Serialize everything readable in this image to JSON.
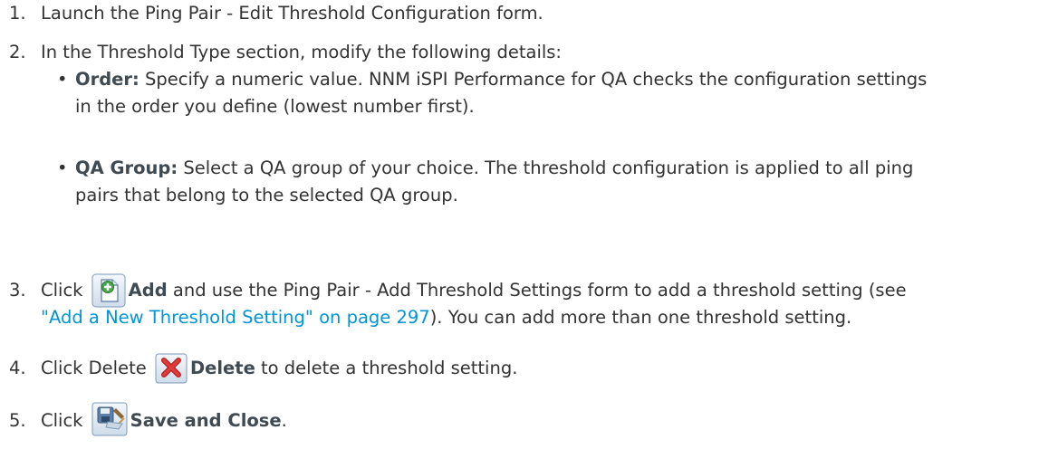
{
  "steps": [
    {
      "num": "1.",
      "text": "Launch the Ping Pair - Edit Threshold Configuration form."
    },
    {
      "num": "2.",
      "text": "In the Threshold Type section, modify the following details:",
      "bullets": [
        {
          "term": "Order:",
          "desc_line1": " Specify a numeric value. NNM iSPI Performance for QA checks the configuration settings",
          "desc_line2": "in the order you define (lowest number first)."
        },
        {
          "term": "QA Group:",
          "desc_line1": " Select a QA group of your choice. The threshold configuration is applied to all ping",
          "desc_line2": "pairs that belong to the selected QA group."
        }
      ]
    },
    {
      "num": "3.",
      "pre": "Click ",
      "icon": "add-icon",
      "bold": "Add",
      "post": " and use the Ping Pair - Add Threshold Settings form to add a threshold setting (see",
      "link": "\"Add a New Threshold Setting\" on page 297",
      "post2": "). You can add more than one threshold setting."
    },
    {
      "num": "4.",
      "pre": "Click Delete ",
      "icon": "delete-icon",
      "bold": "Delete",
      "post": " to delete a threshold setting."
    },
    {
      "num": "5.",
      "pre": "Click ",
      "icon": "save-close-icon",
      "bold": "Save and Close",
      "post": "."
    }
  ],
  "colors": {
    "text": "#333333",
    "link": "#0096d6",
    "bold": "#3f4a53"
  }
}
